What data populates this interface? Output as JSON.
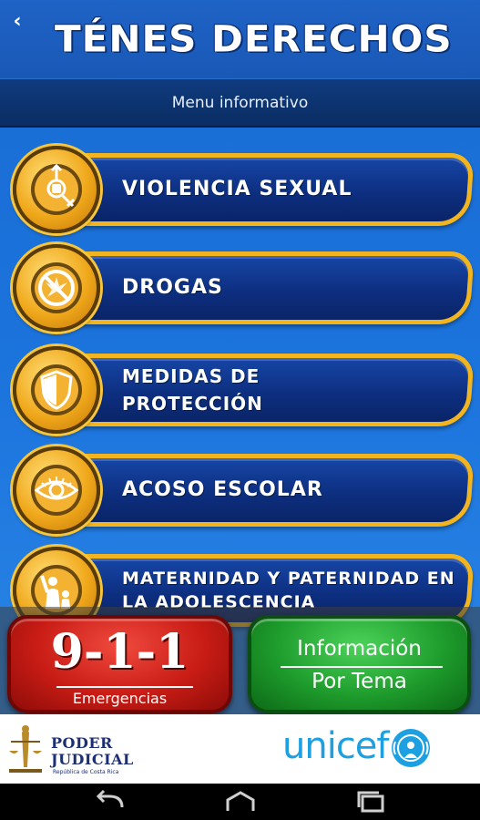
{
  "header": {
    "title": "TÉNES DERECHOS",
    "subtitle": "Menu informativo"
  },
  "menu": {
    "items": [
      {
        "label": "VIOLENCIA SEXUAL",
        "icon": "gender-fist-icon"
      },
      {
        "label": "DROGAS",
        "icon": "no-drugs-icon"
      },
      {
        "label": "MEDIDAS DE PROTECCIÓN",
        "icon": "shield-icon"
      },
      {
        "label": "ACOSO ESCOLAR",
        "icon": "eye-icon"
      },
      {
        "label": "MATERNIDAD Y PATERNIDAD EN LA ADOLESCENCIA",
        "icon": "parent-child-icon"
      }
    ]
  },
  "actions": {
    "emergency_number": "9-1-1",
    "emergency_label": "Emergencias",
    "info_line1": "Información",
    "info_line2": "Por Tema"
  },
  "footer": {
    "pj_line1": "PODER",
    "pj_line2": "JUDICIAL",
    "pj_line3": "República de Costa Rica",
    "unicef": "unicef"
  },
  "colors": {
    "primary_blue": "#1a56b8",
    "banner_gold": "#f2b51f",
    "emergency_red": "#c81c15",
    "info_green": "#1e9c2c",
    "unicef_blue": "#1ca0e1"
  }
}
